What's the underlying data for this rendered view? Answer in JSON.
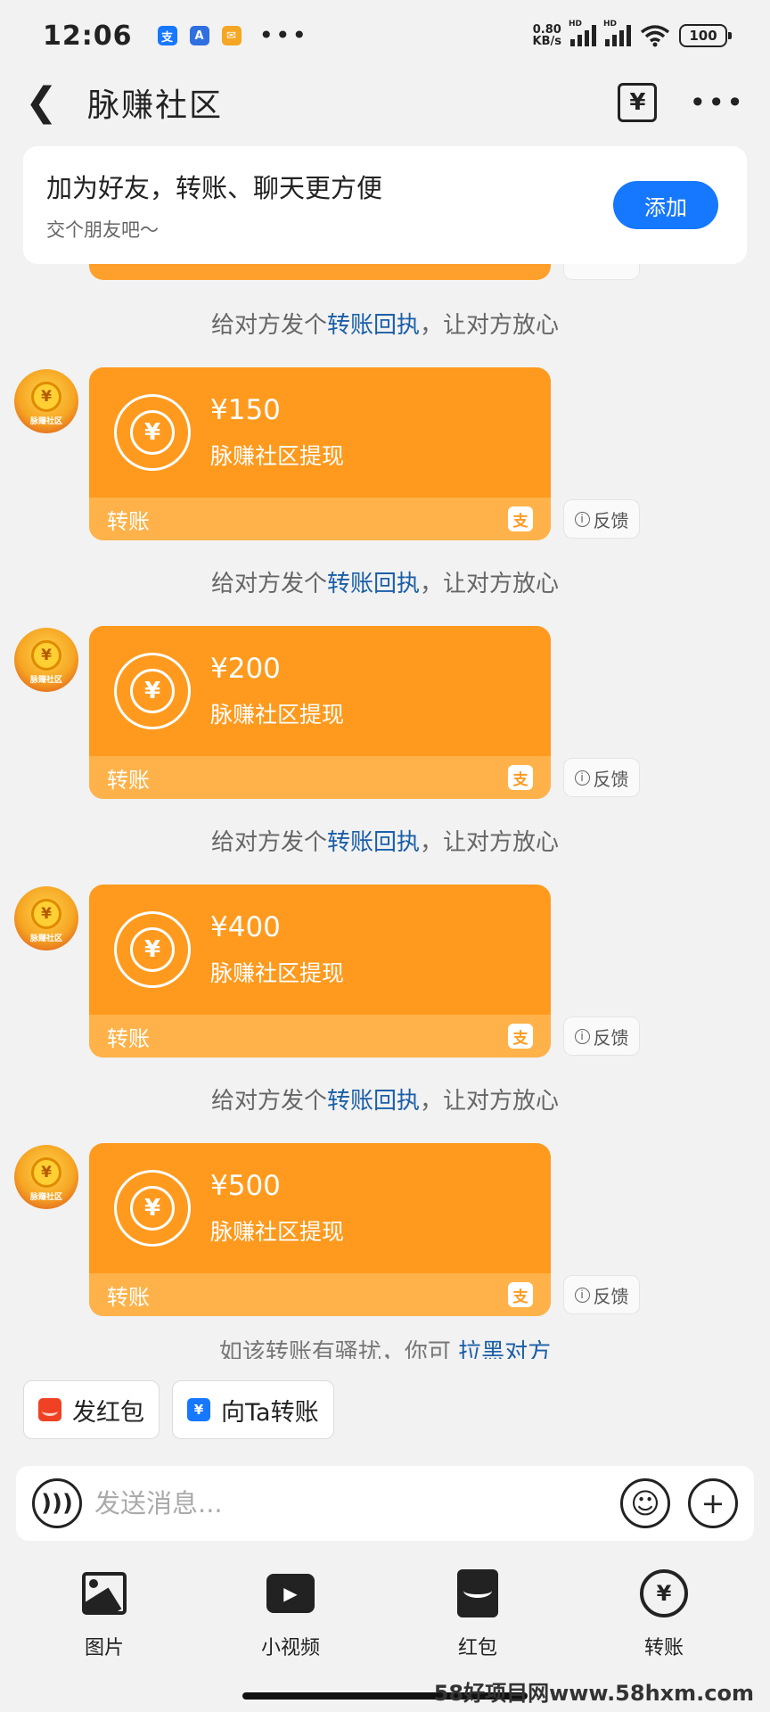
{
  "status": {
    "time": "12:06",
    "net_speed_value": "0.80",
    "net_speed_unit": "KB/s",
    "hd1": "HD",
    "hd2": "HD",
    "battery": "100",
    "dots": "•••"
  },
  "nav": {
    "back": "❮",
    "title": "脉赚社区",
    "record_icon_glyph": "¥",
    "more": "•••"
  },
  "add_card": {
    "title": "加为好友，转账、聊天更方便",
    "subtitle": "交个朋友吧～",
    "button": "添加"
  },
  "notice": {
    "prefix": "给对方发个",
    "link": "转账回执",
    "suffix": "，让对方放心"
  },
  "avatar_label": "脉赚社区",
  "messages": [
    {
      "amount": "¥150",
      "desc": "脉赚社区提现",
      "footer": "转账",
      "feedback": "反馈"
    },
    {
      "amount": "¥200",
      "desc": "脉赚社区提现",
      "footer": "转账",
      "feedback": "反馈"
    },
    {
      "amount": "¥400",
      "desc": "脉赚社区提现",
      "footer": "转账",
      "feedback": "反馈"
    },
    {
      "amount": "¥500",
      "desc": "脉赚社区提现",
      "footer": "转账",
      "feedback": "反馈"
    }
  ],
  "clipped_notice": {
    "text": "如该转账有骚扰，你可",
    "link": "拉黑对方"
  },
  "quick_actions": {
    "red_packet": "发红包",
    "transfer": "向Ta转账"
  },
  "input": {
    "placeholder": "发送消息..."
  },
  "toolbar": {
    "image": "图片",
    "video": "小视频",
    "red_packet": "红包",
    "transfer": "转账"
  },
  "watermark": "58好项目网www.58hxm.com",
  "colors": {
    "accent": "#1677ff",
    "transfer_card": "#ff9a1e",
    "link": "#1a5fa8"
  },
  "icons": [
    "back-icon",
    "transfer-record-icon",
    "more-icon",
    "yen-icon",
    "alipay-icon",
    "info-icon",
    "voice-icon",
    "emoji-icon",
    "plus-icon",
    "image-icon",
    "video-icon",
    "red-packet-icon",
    "transfer-icon"
  ]
}
